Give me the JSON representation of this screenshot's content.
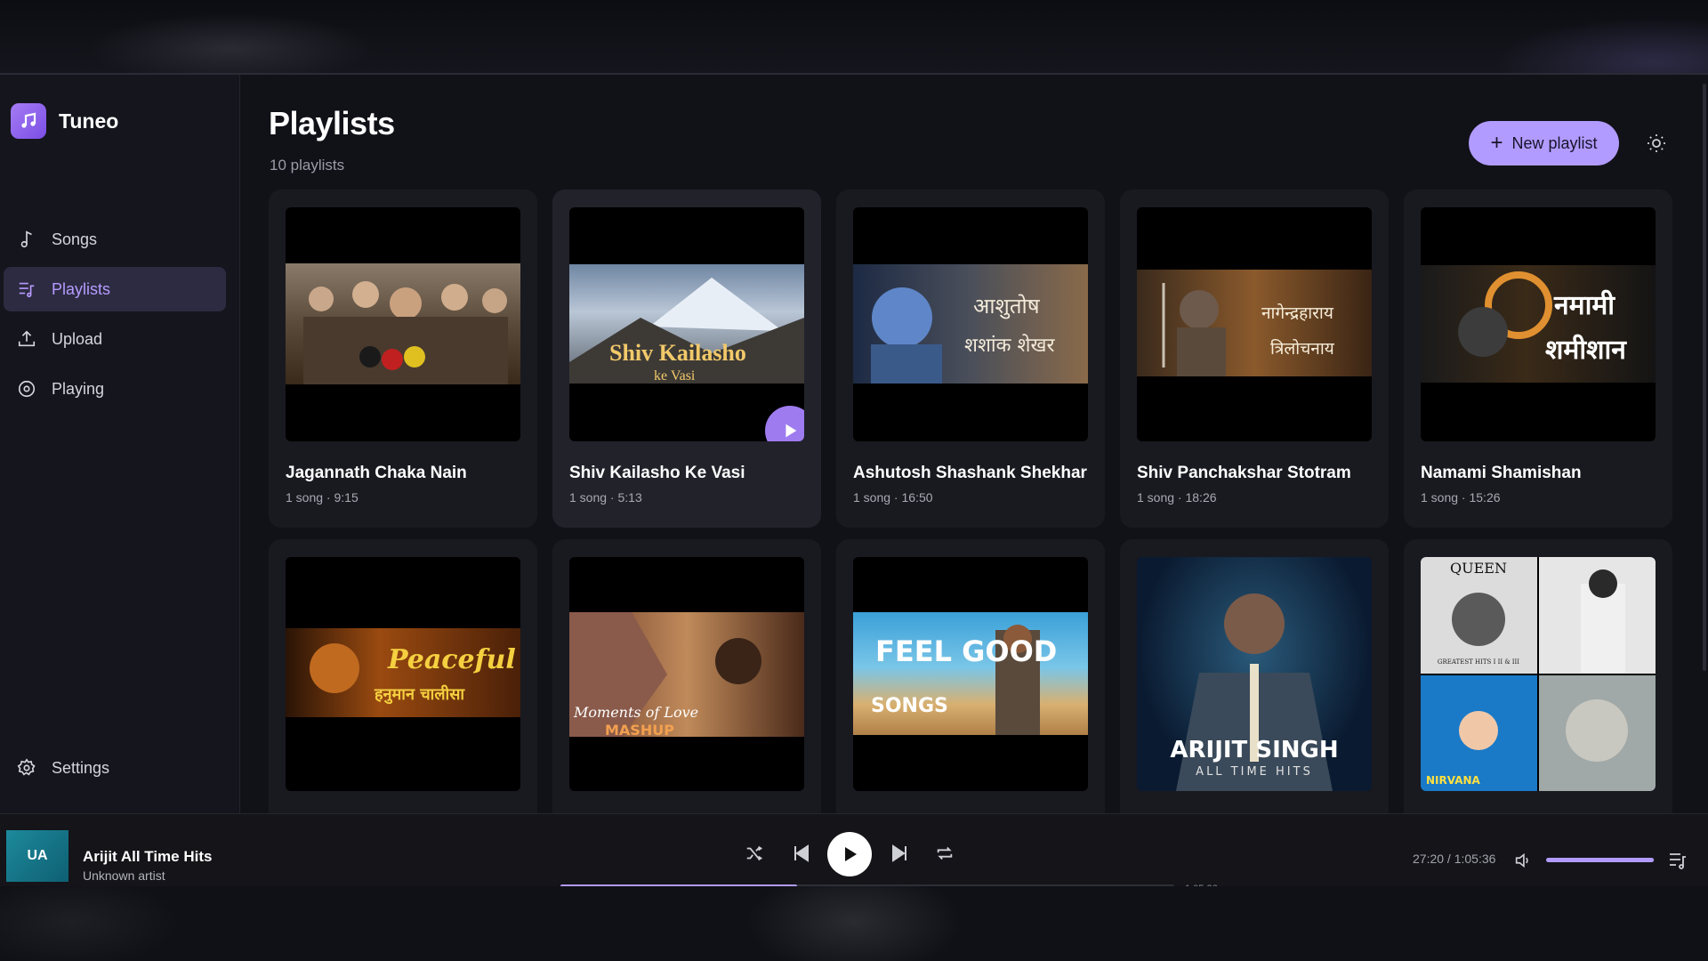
{
  "app": {
    "name": "Tuneo"
  },
  "sidebar": {
    "items": [
      {
        "label": "Songs",
        "icon": "music-note-icon",
        "active": false
      },
      {
        "label": "Playlists",
        "icon": "playlist-icon",
        "active": true
      },
      {
        "label": "Upload",
        "icon": "upload-icon",
        "active": false
      },
      {
        "label": "Playing",
        "icon": "disc-icon",
        "active": false
      }
    ],
    "settings_label": "Settings"
  },
  "header": {
    "title": "Playlists",
    "subtitle": "10 playlists",
    "new_playlist_label": "New playlist"
  },
  "playlists": [
    {
      "title": "Jagannath Chaka Nain",
      "meta": "1 song · 9:15",
      "art_text": "",
      "art_colors": [
        "#6a5a4a",
        "#c9a27a"
      ]
    },
    {
      "title": "Shiv Kailasho Ke Vasi",
      "meta": "1 song · 5:13",
      "art_text": "Shiv Kailasho",
      "art_sub": "ke Vasi",
      "art_colors": [
        "#4a5e78",
        "#b8c4d4"
      ]
    },
    {
      "title": "Ashutosh Shashank Shekhar",
      "meta": "1 song · 16:50",
      "art_text": "आशुतोष",
      "art_sub": "शशांक शेखर",
      "art_colors": [
        "#2a3a5a",
        "#8a6a4a"
      ]
    },
    {
      "title": "Shiv Panchakshar Stotram",
      "meta": "1 song · 18:26",
      "art_text": "नागेन्द्रहाराय",
      "art_sub": "त्रिलोचनाय",
      "art_colors": [
        "#3a2a1a",
        "#c08040"
      ]
    },
    {
      "title": "Namami Shamishan",
      "meta": "1 song · 15:26",
      "art_text": "नमामी",
      "art_sub": "शमीशान",
      "art_colors": [
        "#1a1a1a",
        "#a0601a"
      ]
    },
    {
      "title": "",
      "meta": "",
      "art_text": "Peaceful",
      "art_sub": "हनुमान चालीसा",
      "art_colors": [
        "#3a1a08",
        "#c06010"
      ]
    },
    {
      "title": "",
      "meta": "",
      "art_text": "Moments of Love",
      "art_sub": "MASHUP",
      "art_colors": [
        "#5a3020",
        "#d09050"
      ]
    },
    {
      "title": "",
      "meta": "",
      "art_text": "FEEL GOOD",
      "art_sub": "SONGS",
      "art_colors": [
        "#1a6080",
        "#e0a030"
      ]
    },
    {
      "title": "",
      "meta": "",
      "art_text": "ARIJIT SINGH",
      "art_sub": "ALL TIME HITS",
      "art_colors": [
        "#0a1a30",
        "#2a6a8a"
      ]
    },
    {
      "title": "",
      "meta": "",
      "art_text": "QUEEN",
      "art_sub": "GREATEST HITS I II & III",
      "art_sub2": "NIRVANA",
      "art_colors": [
        "#dcdcdc",
        "#1a70c0"
      ]
    }
  ],
  "player": {
    "now_playing_title": "Arijit All Time Hits",
    "now_playing_artist": "Unknown artist",
    "art_initials": "UA",
    "time_readout": "27:20 / 1:05:36",
    "duration": "1:05:36",
    "progress_fraction": 0.385,
    "volume_fraction": 0.99
  },
  "colors": {
    "accent": "#b29bff",
    "background": "#111118",
    "sidebar_active": "#2c2b41"
  }
}
